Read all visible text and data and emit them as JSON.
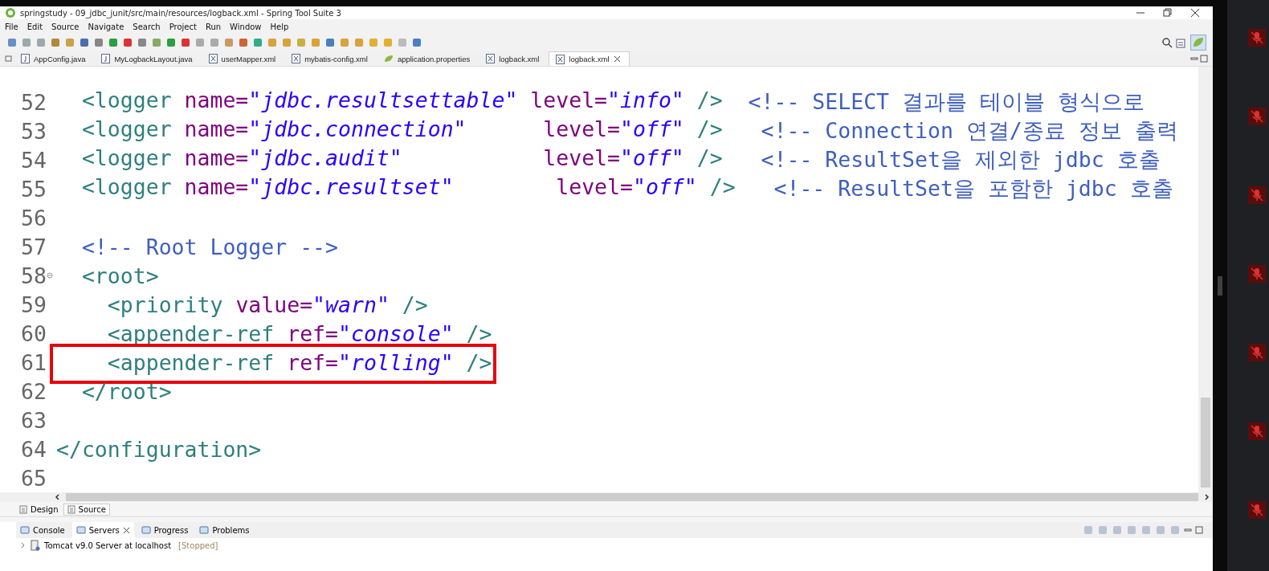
{
  "window": {
    "title": "springstudy - 09_jdbc_junit/src/main/resources/logback.xml - Spring Tool Suite 3"
  },
  "menu": [
    "File",
    "Edit",
    "Source",
    "Navigate",
    "Search",
    "Project",
    "Run",
    "Window",
    "Help"
  ],
  "editor_tabs": [
    {
      "label": "AppConfig.java",
      "kind": "java",
      "selected": false
    },
    {
      "label": "MyLogbackLayout.java",
      "kind": "java",
      "selected": false
    },
    {
      "label": "userMapper.xml",
      "kind": "xml",
      "selected": false
    },
    {
      "label": "mybatis-config.xml",
      "kind": "xml",
      "selected": false
    },
    {
      "label": "application.properties",
      "kind": "properties",
      "selected": false
    },
    {
      "label": "logback.xml",
      "kind": "xml",
      "selected": false
    },
    {
      "label": "logback.xml",
      "kind": "xml",
      "selected": true
    }
  ],
  "code_lines": [
    {
      "number": "52",
      "folding": false,
      "highlighted": false,
      "tokens": [
        {
          "kind": "tag",
          "text": "  <logger"
        },
        {
          "kind": "attr",
          "text": " name="
        },
        {
          "kind": "value",
          "text": "\"jdbc.resultsettable\""
        },
        {
          "kind": "attr",
          "text": " level="
        },
        {
          "kind": "value",
          "text": "\"info\""
        },
        {
          "kind": "tag",
          "text": " />"
        },
        {
          "kind": "comment",
          "text": "  <!-- SELECT 결과를 테이블 형식으로"
        }
      ]
    },
    {
      "number": "53",
      "folding": false,
      "highlighted": false,
      "tokens": [
        {
          "kind": "tag",
          "text": "  <logger"
        },
        {
          "kind": "attr",
          "text": " name="
        },
        {
          "kind": "value",
          "text": "\"jdbc.connection\""
        },
        {
          "kind": "attr",
          "text": "      level="
        },
        {
          "kind": "value",
          "text": "\"off\""
        },
        {
          "kind": "tag",
          "text": " />"
        },
        {
          "kind": "comment",
          "text": "   <!-- Connection 연결/종료 정보 출력"
        }
      ]
    },
    {
      "number": "54",
      "folding": false,
      "highlighted": false,
      "tokens": [
        {
          "kind": "tag",
          "text": "  <logger"
        },
        {
          "kind": "attr",
          "text": " name="
        },
        {
          "kind": "value",
          "text": "\"jdbc.audit\""
        },
        {
          "kind": "attr",
          "text": "           level="
        },
        {
          "kind": "value",
          "text": "\"off\""
        },
        {
          "kind": "tag",
          "text": " />"
        },
        {
          "kind": "comment",
          "text": "   <!-- ResultSet을 제외한 jdbc 호출"
        }
      ]
    },
    {
      "number": "55",
      "folding": false,
      "highlighted": false,
      "tokens": [
        {
          "kind": "tag",
          "text": "  <logger"
        },
        {
          "kind": "attr",
          "text": " name="
        },
        {
          "kind": "value",
          "text": "\"jdbc.resultset\""
        },
        {
          "kind": "attr",
          "text": "        level="
        },
        {
          "kind": "value",
          "text": "\"off\""
        },
        {
          "kind": "tag",
          "text": " />"
        },
        {
          "kind": "comment",
          "text": "   <!-- ResultSet을 포함한 jdbc 호출"
        }
      ]
    },
    {
      "number": "56",
      "folding": false,
      "highlighted": false
    },
    {
      "number": "57",
      "folding": false,
      "highlighted": false,
      "tokens": [
        {
          "kind": "comment",
          "text": "  <!-- Root Logger -->"
        }
      ]
    },
    {
      "number": "58",
      "folding": true,
      "highlighted": false,
      "tokens": [
        {
          "kind": "tag",
          "text": "  <root>"
        }
      ]
    },
    {
      "number": "59",
      "folding": false,
      "highlighted": false,
      "tokens": [
        {
          "kind": "tag",
          "text": "    <priority"
        },
        {
          "kind": "attr",
          "text": " value="
        },
        {
          "kind": "value",
          "text": "\"warn\""
        },
        {
          "kind": "tag",
          "text": " />"
        }
      ]
    },
    {
      "number": "60",
      "folding": false,
      "highlighted": false,
      "tokens": [
        {
          "kind": "tag",
          "text": "    <appender-ref"
        },
        {
          "kind": "attr",
          "text": " ref="
        },
        {
          "kind": "value",
          "text": "\"console\""
        },
        {
          "kind": "tag",
          "text": " />"
        }
      ]
    },
    {
      "number": "61",
      "folding": false,
      "highlighted": true,
      "tokens": [
        {
          "kind": "tag",
          "text": "    <appender-ref"
        },
        {
          "kind": "attr",
          "text": " ref="
        },
        {
          "kind": "value",
          "text": "\"rolling\""
        },
        {
          "kind": "tag",
          "text": " />"
        }
      ]
    },
    {
      "number": "62",
      "folding": false,
      "highlighted": false,
      "tokens": [
        {
          "kind": "tag",
          "text": "  </root>"
        }
      ]
    },
    {
      "number": "63",
      "folding": false,
      "highlighted": false
    },
    {
      "number": "64",
      "folding": false,
      "highlighted": false,
      "tokens": [
        {
          "kind": "tag",
          "text": "</configuration>"
        }
      ]
    },
    {
      "number": "65",
      "folding": false,
      "highlighted": false
    }
  ],
  "view_tabs": [
    {
      "label": "Design",
      "selected": false
    },
    {
      "label": "Source",
      "selected": true
    }
  ],
  "panel_tabs": [
    {
      "label": "Console",
      "selected": false
    },
    {
      "label": "Servers",
      "selected": true
    },
    {
      "label": "Progress",
      "selected": false
    },
    {
      "label": "Problems",
      "selected": false
    }
  ],
  "servers": [
    {
      "name": "Tomcat v9.0 Server at localhost",
      "status": "[Stopped]"
    }
  ]
}
